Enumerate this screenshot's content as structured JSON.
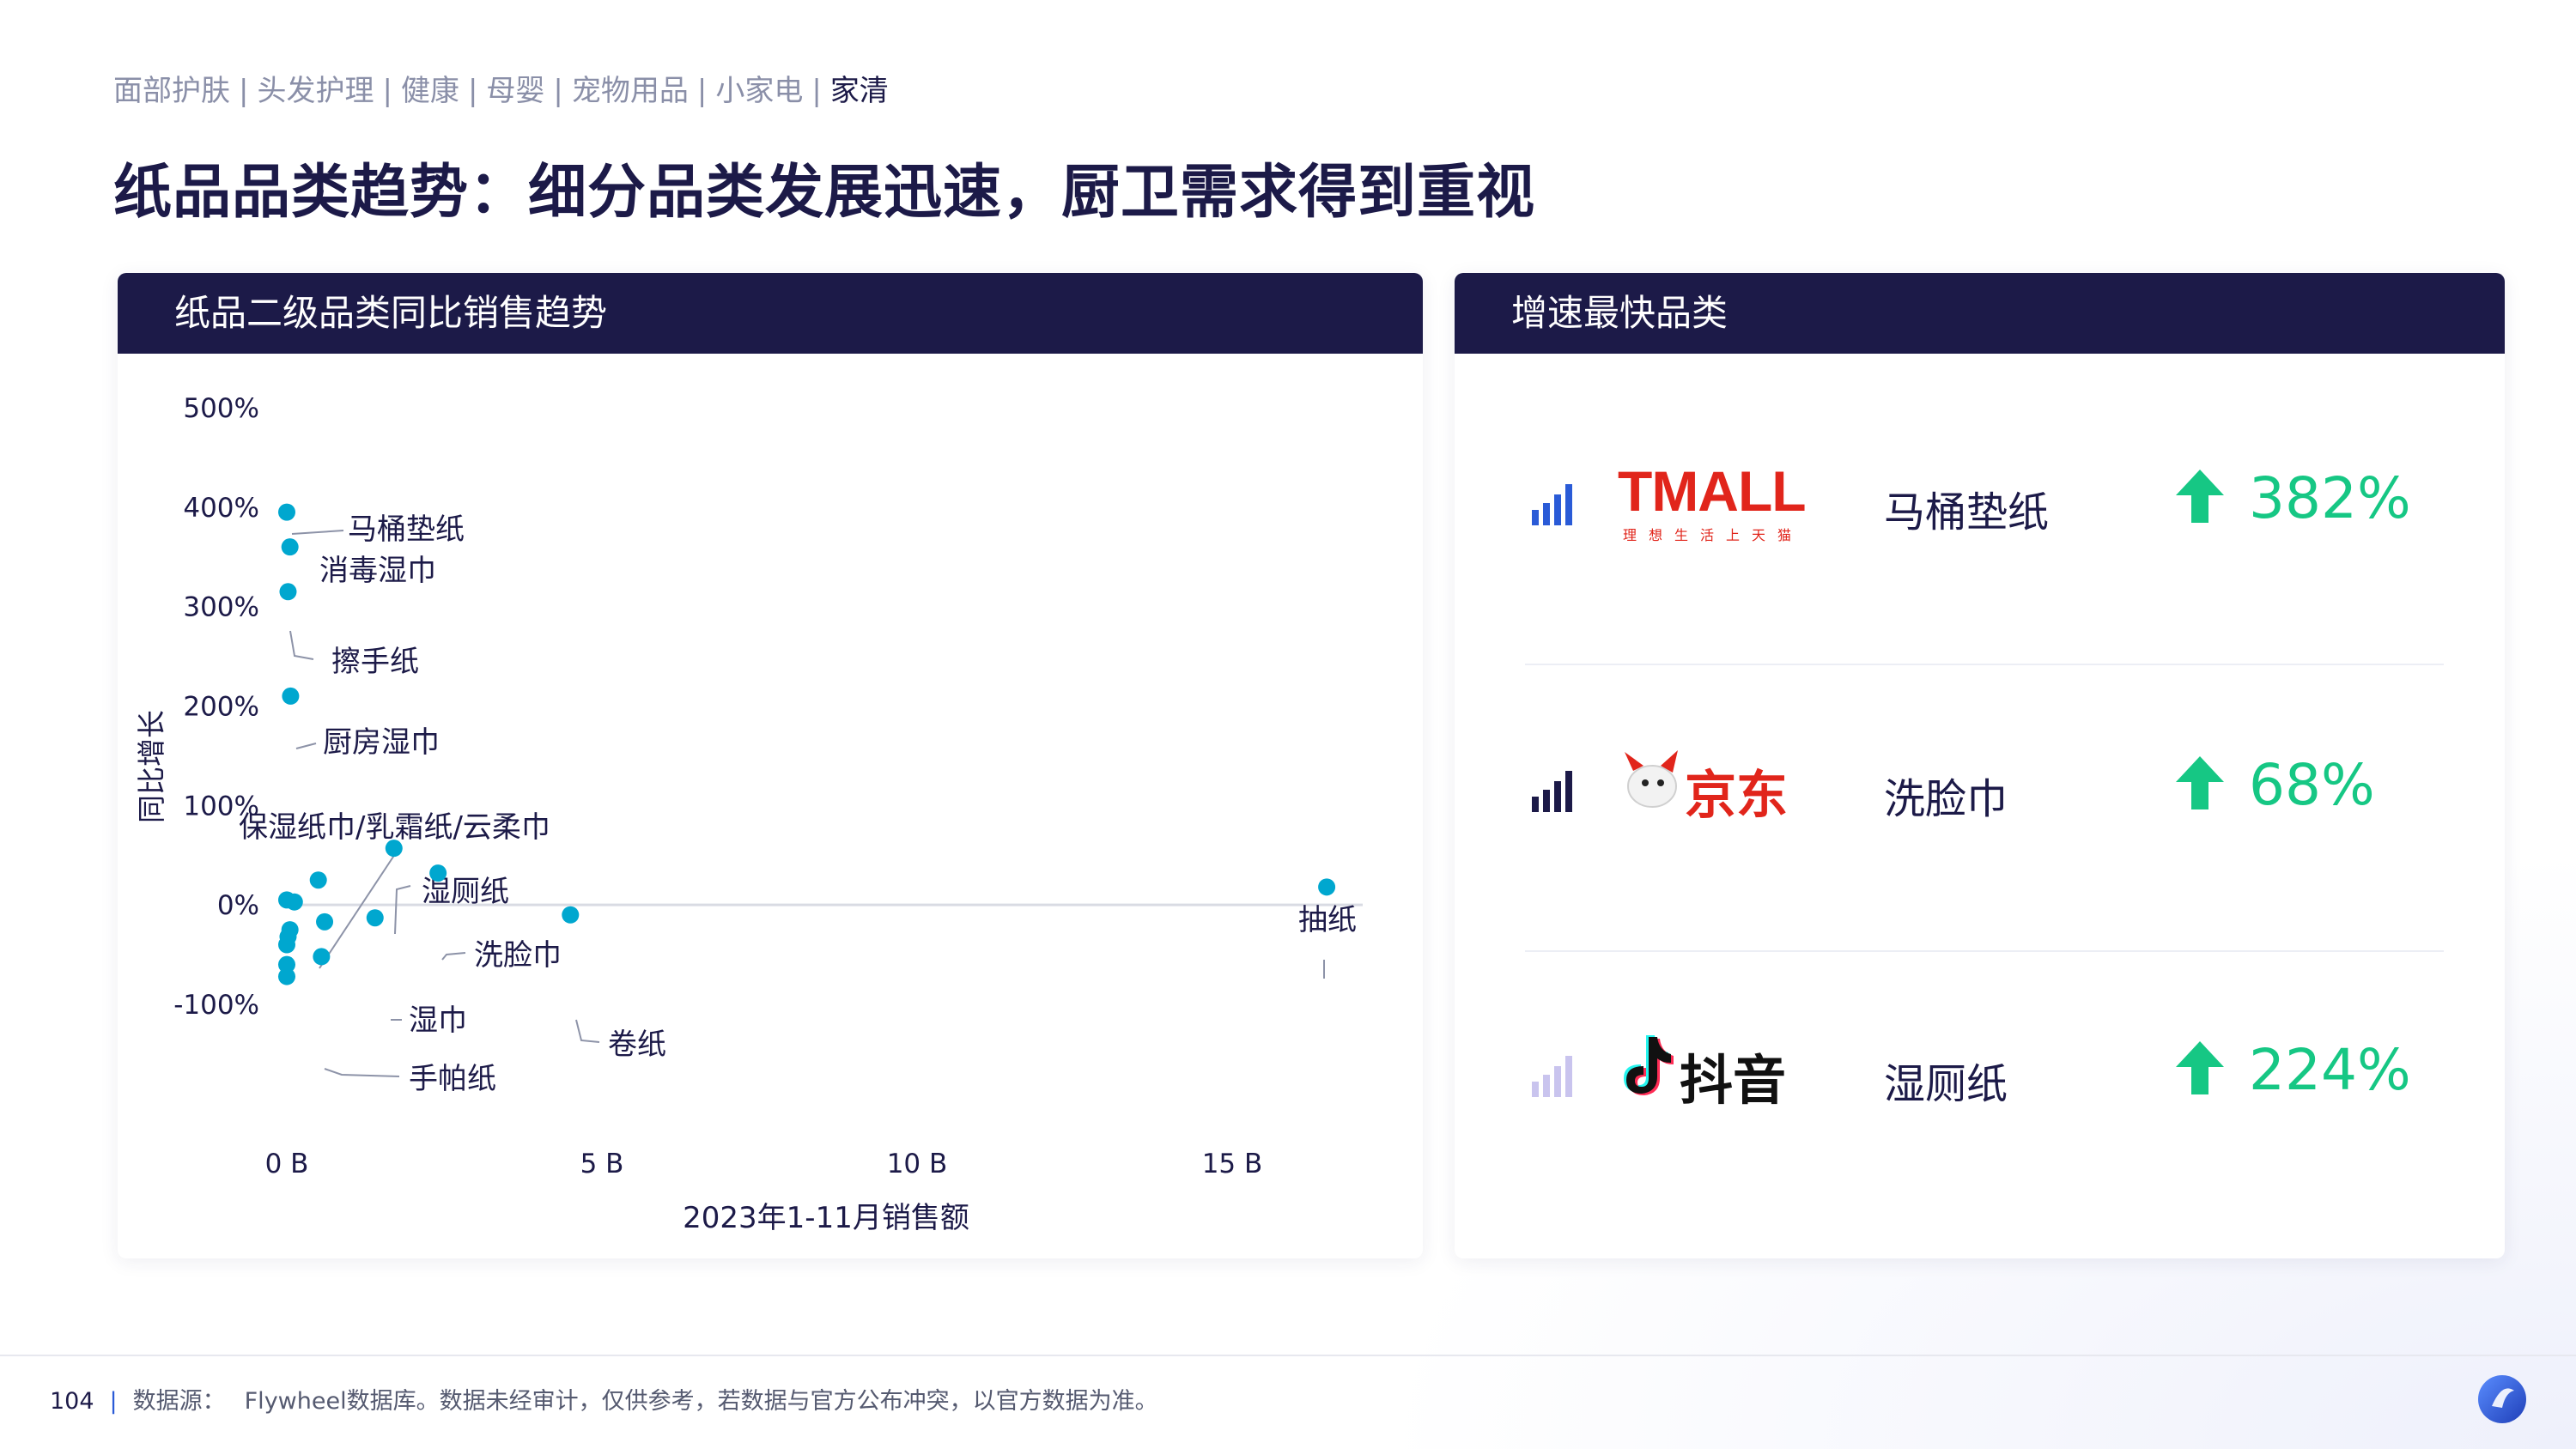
{
  "nav": {
    "items": [
      "面部护肤",
      "头发护理",
      "健康",
      "母婴",
      "宠物用品",
      "小家电",
      "家清"
    ],
    "separator": "|",
    "active_index": 6
  },
  "title": "纸品品类趋势：细分品类发展迅速，厨卫需求得到重视",
  "left_panel": {
    "header": "纸品二级品类同比销售趋势"
  },
  "chart_data": {
    "type": "scatter",
    "xlabel": "2023年1-11月销售额",
    "ylabel": "同比增长",
    "x_unit": "B",
    "xlim": [
      0,
      17
    ],
    "ylim": [
      -100,
      500
    ],
    "x_ticks": [
      0,
      5,
      10,
      15
    ],
    "x_tick_labels": [
      "0 B",
      "5 B",
      "10 B",
      "15 B"
    ],
    "y_ticks": [
      -100,
      0,
      100,
      200,
      300,
      400,
      500
    ],
    "y_tick_labels": [
      "-100%",
      "0%",
      "100%",
      "200%",
      "300%",
      "400%",
      "500%"
    ],
    "grid": false,
    "reference_line_y": 0,
    "point_color": "#00a7cf",
    "points": [
      {
        "label": "马桶垫纸",
        "x": 0.0,
        "y": 395
      },
      {
        "label": "消毒湿巾",
        "x": 0.05,
        "y": 360
      },
      {
        "label": "擦手纸",
        "x": 0.02,
        "y": 315
      },
      {
        "label": "厨房湿巾",
        "x": 0.06,
        "y": 210
      },
      {
        "label": "保湿纸巾/乳霜纸/云柔巾",
        "x": 0.5,
        "y": 25
      },
      {
        "label": "湿厕纸",
        "x": 1.7,
        "y": 57
      },
      {
        "label": "洗脸巾",
        "x": 2.4,
        "y": 32
      },
      {
        "label": "抽纸",
        "x": 16.5,
        "y": 18
      },
      {
        "label": "卷纸",
        "x": 4.5,
        "y": -10
      },
      {
        "label": "湿巾",
        "x": 1.4,
        "y": -13
      },
      {
        "label": "手帕纸",
        "x": 0.55,
        "y": -52
      },
      {
        "label": "",
        "x": 0.0,
        "y": 5
      },
      {
        "label": "",
        "x": 0.12,
        "y": 3
      },
      {
        "label": "",
        "x": 0.6,
        "y": -17
      },
      {
        "label": "",
        "x": 0.05,
        "y": -25
      },
      {
        "label": "",
        "x": 0.02,
        "y": -32
      },
      {
        "label": "",
        "x": 0.0,
        "y": -40
      },
      {
        "label": "",
        "x": 0.0,
        "y": -60
      },
      {
        "label": "",
        "x": 0.0,
        "y": -72
      }
    ]
  },
  "right_panel": {
    "header": "增速最快品类",
    "rows": [
      {
        "platform": "TMALL",
        "platform_sub": "理想生活上天猫",
        "category": "马桶垫纸",
        "growth": "382%",
        "signal_color": "#2a5bd7",
        "logo_icon": "tmall-logo"
      },
      {
        "platform": "京东",
        "category": "洗脸巾",
        "growth": "68%",
        "signal_color": "#1c1a48",
        "logo_icon": "jd-logo"
      },
      {
        "platform": "抖音",
        "category": "湿厕纸",
        "growth": "224%",
        "signal_color": "#c9c4ee",
        "logo_icon": "douyin-logo"
      }
    ],
    "arrow_color": "#16c784"
  },
  "footer": {
    "page_number": "104",
    "source_label": "数据源：",
    "source_text": "Flywheel数据库。数据未经审计，仅供参考，若数据与官方公布冲突，以官方数据为准。"
  }
}
